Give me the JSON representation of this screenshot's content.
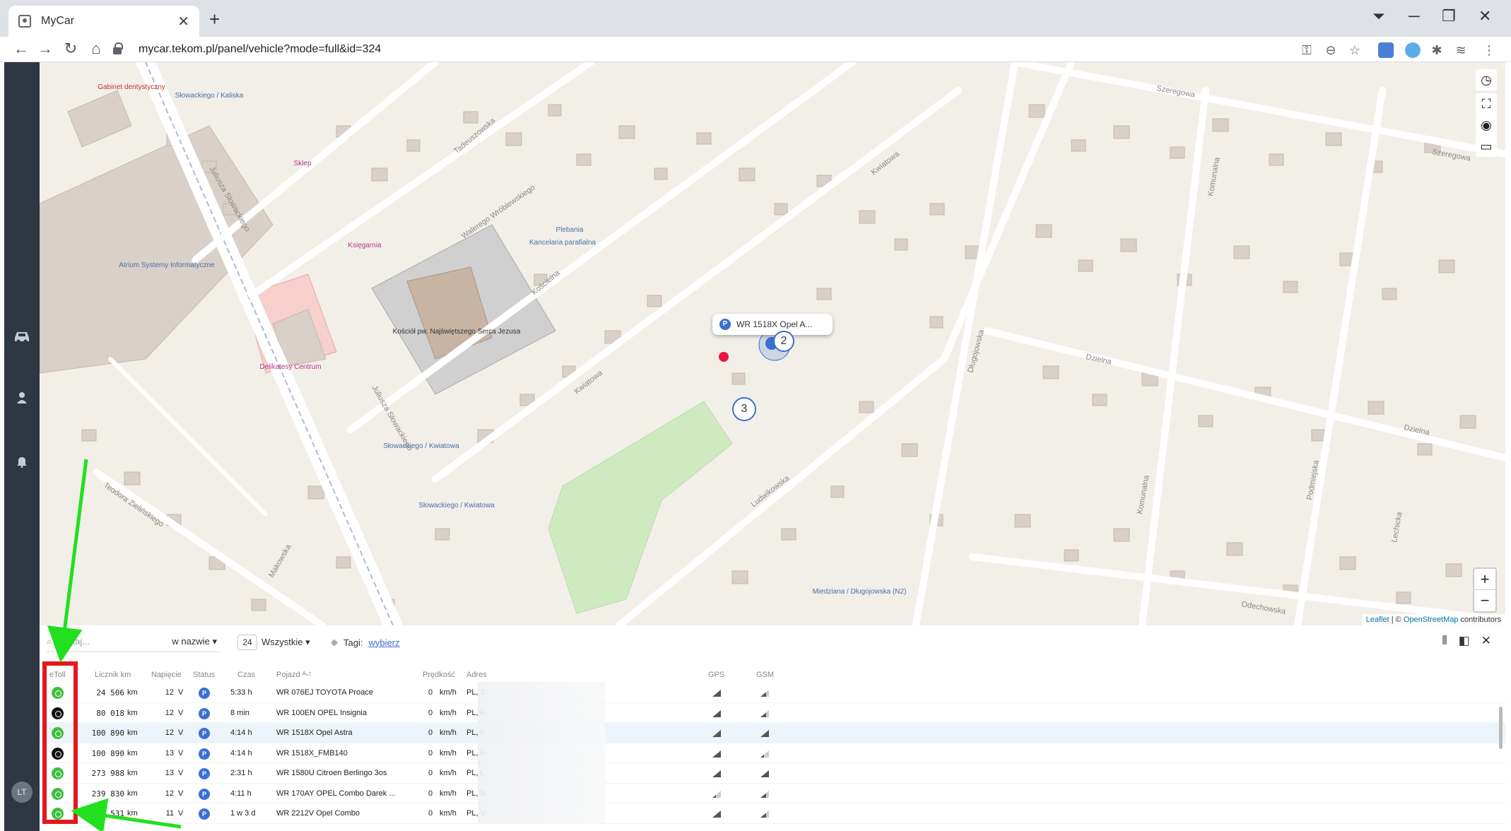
{
  "browser": {
    "tab_title": "MyCar",
    "url": "mycar.tekom.pl/panel/vehicle?mode=full&id=324"
  },
  "sidebar": {
    "avatar_initials": "LT"
  },
  "map": {
    "popup_text": "WR 1518X Opel A...",
    "clusters": [
      "2",
      "3"
    ],
    "attribution": {
      "leaflet": "Leaflet",
      "sep": " | © ",
      "osm": "OpenStreetMap",
      "contrib": " contributors"
    },
    "labels": {
      "street1": "Juliusza Słowackiego",
      "street2": "Juliusza Słowackiego",
      "street3": "Walerego Wróblewskiego",
      "street4": "Kościelna",
      "street5": "Kwiatowa",
      "street6": "Kwiatowa",
      "street7": "Ludwikowska",
      "street8": "Długojowska",
      "street9": "Dzielna",
      "street10": "Dzielna",
      "street11": "Szeregowa",
      "street12": "Szeregowa",
      "street13": "Komunalna",
      "street14": "Komunalna",
      "street15": "Podmiejska",
      "street16": "Lechicka",
      "street17": "Odechowska",
      "street18": "Teodora Zielińskiego",
      "street19": "Makowska",
      "street20": "Tadeuszowska",
      "poi1": "Gabinet dentystyczny",
      "poi2": "Słowackiego / Kaliska",
      "poi3": "Sklep",
      "poi4": "Księgarnia",
      "poi5": "Plebania",
      "poi6": "Kancelaria parafialna",
      "poi7": "Kościół pw. Najświętszego Serca Jezusa",
      "poi8": "Delikatesy Centrum",
      "poi9": "Słowackiego / Kwiatowa",
      "poi10": "Słowackiego / Kwiatowa",
      "poi11": "Miedziana / Długojowska (N2)",
      "poi12": "Atrium Systemy Informatyczne"
    }
  },
  "filters": {
    "search_placeholder": "Szukaj...",
    "search_mode": "w nazwie ▾",
    "count": "24",
    "status": "Wszystkie ▾",
    "tags_label": "Tagi:",
    "tags_link": "wybierz"
  },
  "table": {
    "headers": {
      "etoll": "eToll",
      "odometer": "Licznik km",
      "voltage": "Napięcie",
      "status": "Status",
      "time": "Czas",
      "vehicle": "Pojazd ᴬ-ᶻ",
      "speed": "Prędkość",
      "address": "Adres",
      "gps": "GPS",
      "gsm": "GSM"
    },
    "rows": [
      {
        "etoll": "on",
        "odo": "24 506",
        "km": "km",
        "volt": "12",
        "v": "V",
        "status": "P",
        "time": "5:33 h",
        "vehicle": "WR 076EJ TOYOTA Proace",
        "speed": "0",
        "kmh": "km/h",
        "addr": "PL, J"
      },
      {
        "etoll": "off",
        "odo": "80 018",
        "km": "km",
        "volt": "12",
        "v": "V",
        "status": "P",
        "time": "8 min",
        "vehicle": "WR 100EN OPEL Insignia",
        "speed": "0",
        "kmh": "km/h",
        "addr": "PL, F"
      },
      {
        "etoll": "on",
        "odo": "100 890",
        "km": "km",
        "volt": "12",
        "v": "V",
        "status": "P",
        "time": "4:14 h",
        "vehicle": "WR 1518X Opel Astra",
        "speed": "0",
        "kmh": "km/h",
        "addr": "PL, F"
      },
      {
        "etoll": "off",
        "odo": "100 890",
        "km": "km",
        "volt": "13",
        "v": "V",
        "status": "P",
        "time": "4:14 h",
        "vehicle": "WR 1518X_FMB140",
        "speed": "0",
        "kmh": "km/h",
        "addr": "PL, F"
      },
      {
        "etoll": "on",
        "odo": "273 988",
        "km": "km",
        "volt": "13",
        "v": "V",
        "status": "P",
        "time": "2:31 h",
        "vehicle": "WR 1580U Citroen Berlingo 3os",
        "speed": "0",
        "kmh": "km/h",
        "addr": "PL, Ł"
      },
      {
        "etoll": "on",
        "odo": "239 830",
        "km": "km",
        "volt": "12",
        "v": "V",
        "status": "P",
        "time": "4:11 h",
        "vehicle": "WR 170AY OPEL Combo Darek ...",
        "speed": "0",
        "kmh": "km/h",
        "addr": "PL, S"
      },
      {
        "etoll": "on",
        "odo": "276 531",
        "km": "km",
        "volt": "11",
        "v": "V",
        "status": "P",
        "time": "1 w 3 d",
        "vehicle": "WR 2212V Opel Combo",
        "speed": "0",
        "kmh": "km/h",
        "addr": "PL, V"
      }
    ]
  },
  "colors": {
    "accent": "#3b6fd4",
    "annotation_red": "#e5171c",
    "annotation_green": "#22e01f",
    "etoll_on": "#3fbf3f",
    "etoll_off": "#111111"
  }
}
